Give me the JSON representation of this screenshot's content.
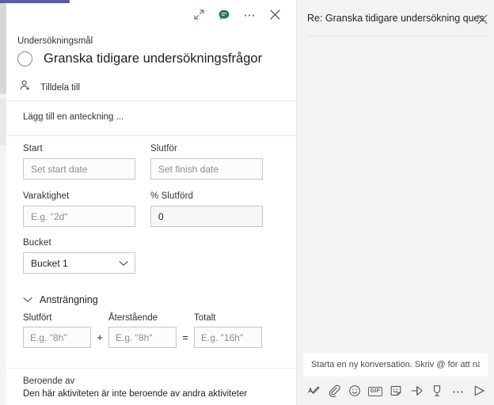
{
  "task": {
    "toolbar": {
      "expand_label": "expand-icon",
      "chat_label": "chat-icon",
      "more_label": "⋯",
      "close_label": "close-icon"
    },
    "goal_label": "Undersökningsmål",
    "title": "Granska tidigare undersökningsfrågor",
    "assign_label": "Tilldela till",
    "note_placeholder": "Lägg till en anteckning ...",
    "fields": {
      "start_label": "Start",
      "start_placeholder": "Set start date",
      "start_value": "",
      "finish_label": "Slutför",
      "finish_placeholder": "Set finish date",
      "finish_value": "",
      "duration_label": "Varaktighet",
      "duration_placeholder": "E.g. \"2d\"",
      "duration_value": "",
      "percent_label": "% Slutförd",
      "percent_placeholder": "",
      "percent_value": "0",
      "bucket_label": "Bucket",
      "bucket_value": "Bucket 1"
    },
    "effort": {
      "section_title": "Ansträngning",
      "completed_label": "Slutfört",
      "completed_placeholder": "E.g. \"8h\"",
      "completed_value": "",
      "plus_operator": "+",
      "remaining_label": "Återstående",
      "remaining_placeholder": "E.g. \"8h\"",
      "remaining_value": "",
      "equals_operator": "=",
      "total_label": "Totalt",
      "total_placeholder": "E.g. \"16h\"",
      "total_value": ""
    },
    "dependency": {
      "title": "Beroende av",
      "description": "Den här aktiviteten är inte beroende av andra aktiviteter"
    }
  },
  "chat": {
    "title": "Re: Granska tidigare undersökning ques…",
    "compose_placeholder": "Starta en ny konversation. Skriv @ för att nämna ...",
    "toolbar": [
      {
        "name": "format-icon",
        "glyph": ""
      },
      {
        "name": "attach-icon",
        "glyph": ""
      },
      {
        "name": "emoji-icon",
        "glyph": ""
      },
      {
        "name": "gif-icon",
        "glyph": "GIF"
      },
      {
        "name": "sticker-icon",
        "glyph": ""
      },
      {
        "name": "praise-send-icon",
        "glyph": ""
      },
      {
        "name": "praise-badge-icon",
        "glyph": ""
      },
      {
        "name": "more-options-icon",
        "glyph": "⋯"
      },
      {
        "name": "send-icon",
        "glyph": ""
      }
    ]
  },
  "colors": {
    "accent": "#5b5ea6",
    "chat_green": "#237b4b",
    "panel_bg": "#f4f3f2",
    "border": "#c8c6c4"
  }
}
